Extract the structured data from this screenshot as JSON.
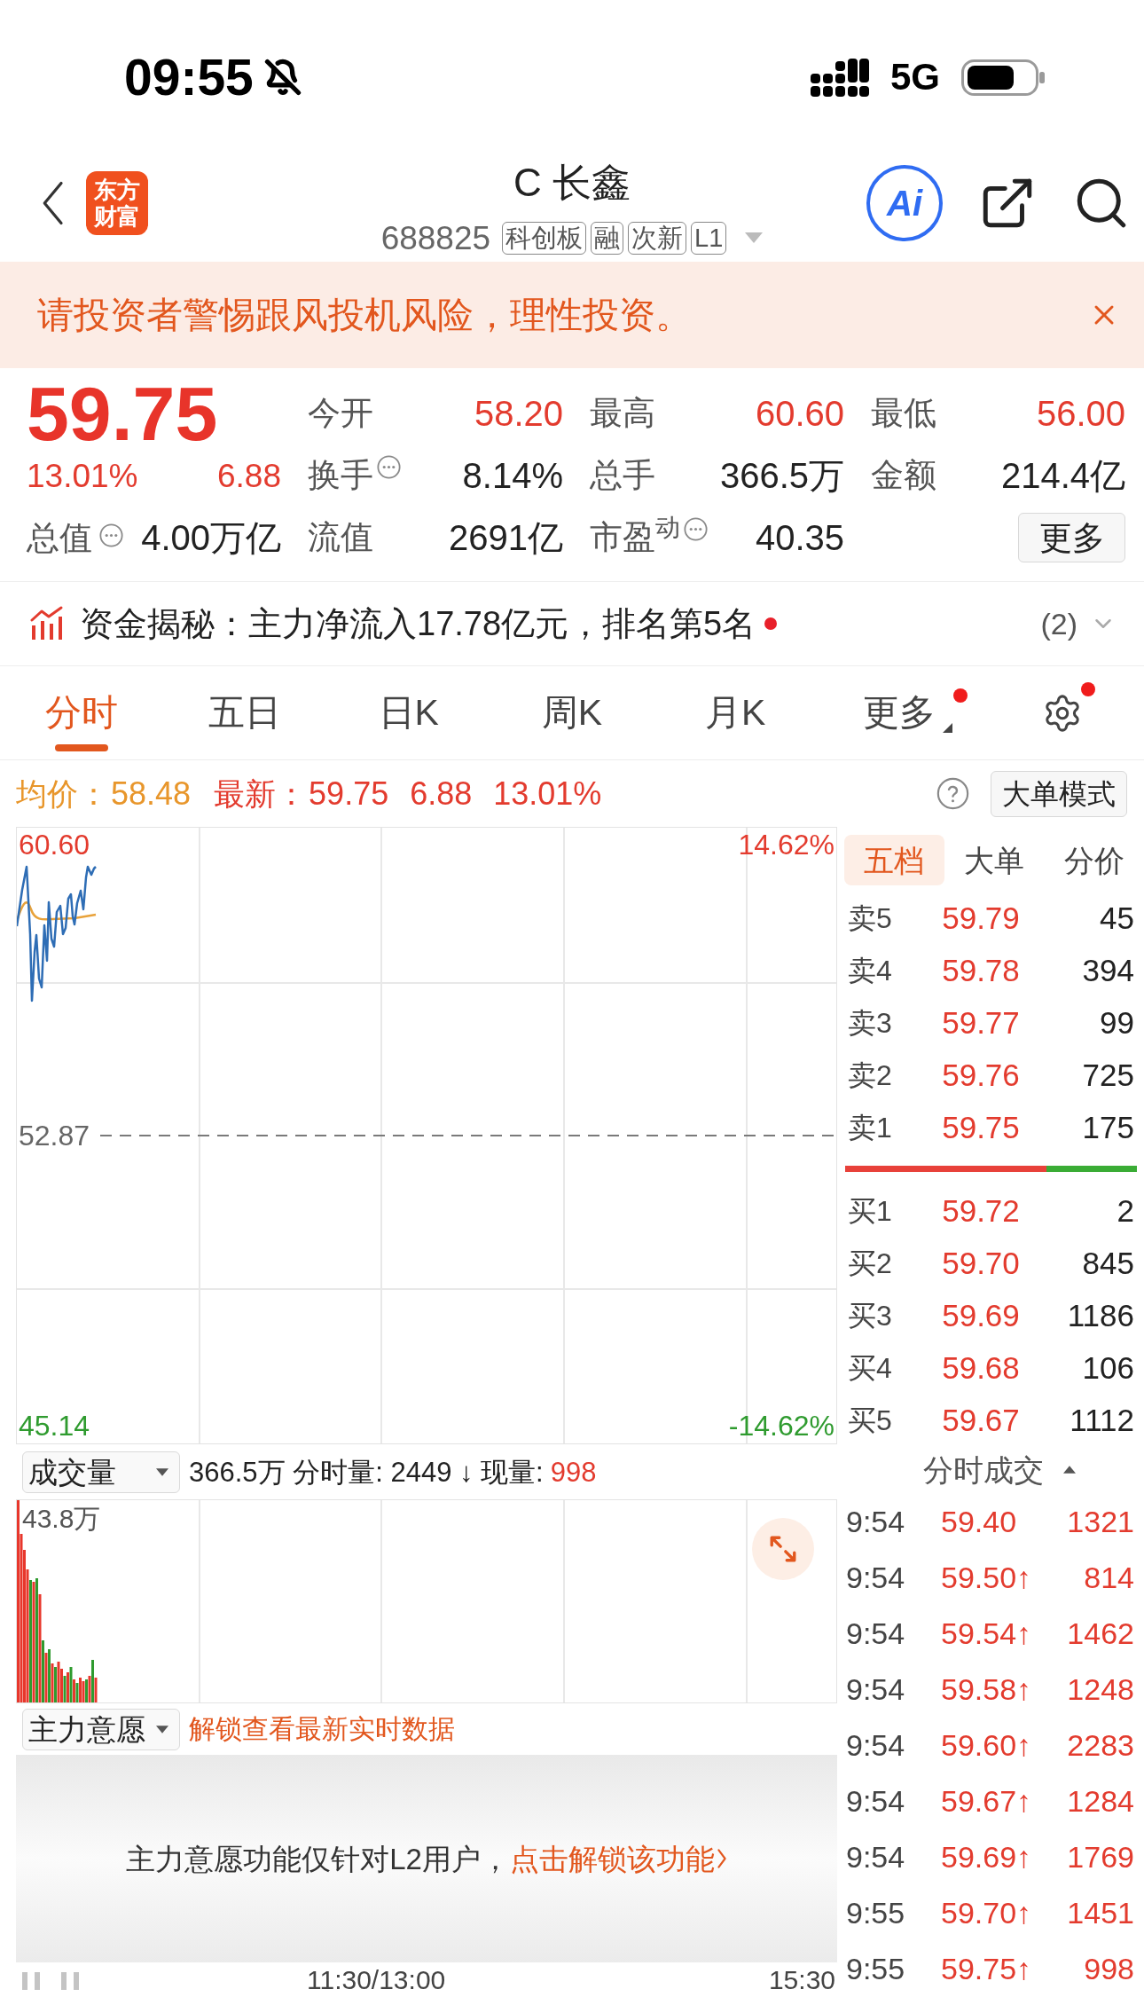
{
  "status_bar": {
    "time": "09:55",
    "network": "5G"
  },
  "header": {
    "logo": [
      "东方",
      "财富"
    ],
    "title": "C 长鑫",
    "code": "688825",
    "tags": [
      "科创板",
      "融",
      "次新",
      "L1"
    ],
    "ai_button": "Ai"
  },
  "notice": {
    "text": "请投资者警惕跟风投机风险，理性投资。"
  },
  "quote": {
    "price": "59.75",
    "change_pct": "13.01%",
    "change": "6.88",
    "total_value": {
      "label": "总值",
      "info": true,
      "value": "4.00万亿"
    },
    "stats": [
      [
        {
          "label": "今开",
          "info": false,
          "value": "58.20",
          "color": "#e33b2e"
        },
        {
          "label": "最高",
          "info": false,
          "value": "60.60",
          "color": "#e33b2e"
        },
        {
          "label": "最低",
          "info": false,
          "value": "56.00",
          "color": "#e33b2e"
        }
      ],
      [
        {
          "label": "换手",
          "info": true,
          "value": "8.14%",
          "color": "#222222"
        },
        {
          "label": "总手",
          "info": false,
          "value": "366.5万",
          "color": "#222222"
        },
        {
          "label": "金额",
          "info": false,
          "value": "214.4亿",
          "color": "#222222"
        }
      ],
      [
        {
          "label": "流值",
          "info": false,
          "value": "2691亿",
          "color": "#222222"
        },
        {
          "label": "市盈$^{动}$",
          "info": true,
          "value": "40.35",
          "color": "#222222"
        }
      ]
    ],
    "more_button": "更多"
  },
  "fund_flow": {
    "text": "资金揭秘：主力净流入17.78亿元，排名第5名",
    "unread": true,
    "count": "(2)"
  },
  "tabs": [
    {
      "label": "分时",
      "kind": "period",
      "selected": true,
      "badge": false
    },
    {
      "label": "五日",
      "kind": "period",
      "selected": false,
      "badge": false
    },
    {
      "label": "日K",
      "kind": "period",
      "selected": false,
      "badge": false
    },
    {
      "label": "周K",
      "kind": "period",
      "selected": false,
      "badge": false
    },
    {
      "label": "月K",
      "kind": "period",
      "selected": false,
      "badge": false
    },
    {
      "label": "更多",
      "kind": "menu",
      "selected": false,
      "badge": true
    }
  ],
  "settings": {
    "badge": true
  },
  "summary": {
    "avg_label": "均价：",
    "avg": "58.48",
    "latest_label": "最新：",
    "latest": "59.75",
    "change": "6.88",
    "change_pct": "13.01%",
    "mode_button": "大单模式"
  },
  "chart": {
    "high": "60.60",
    "high_pct": "14.62%",
    "prev_close": "52.87",
    "low": "45.14",
    "low_pct": "-14.62%"
  },
  "order_book": {
    "tabs": [
      {
        "label": "五档",
        "selected": true
      },
      {
        "label": "大单",
        "selected": false
      },
      {
        "label": "分价",
        "selected": false
      }
    ],
    "asks": [
      {
        "label": "卖5",
        "price": "59.79",
        "volume": "45"
      },
      {
        "label": "卖4",
        "price": "59.78",
        "volume": "394"
      },
      {
        "label": "卖3",
        "price": "59.77",
        "volume": "99"
      },
      {
        "label": "卖2",
        "price": "59.76",
        "volume": "725"
      },
      {
        "label": "卖1",
        "price": "59.75",
        "volume": "175"
      }
    ],
    "balance": {
      "level": 0.69
    },
    "bids": [
      {
        "label": "买1",
        "price": "59.72",
        "volume": "2"
      },
      {
        "label": "买2",
        "price": "59.70",
        "volume": "845"
      },
      {
        "label": "买3",
        "price": "59.69",
        "volume": "1186"
      },
      {
        "label": "买4",
        "price": "59.68",
        "volume": "106"
      },
      {
        "label": "买5",
        "price": "59.67",
        "volume": "1112"
      }
    ]
  },
  "volume": {
    "selector": "成交量",
    "summary": "366.5万 分时量: 2449 ↓ 现量:",
    "current": "998",
    "max": "43.8万"
  },
  "intent": {
    "selector": "主力意愿",
    "hint": "解锁查看最新实时数据",
    "message": "主力意愿功能仅针对L2用户，",
    "link": "点击解锁该功能"
  },
  "trades": {
    "title": "分时成交",
    "rows": [
      {
        "time": "9:54",
        "price": "59.40",
        "volume": "1321"
      },
      {
        "time": "9:54",
        "price": "59.50↑",
        "volume": "814"
      },
      {
        "time": "9:54",
        "price": "59.54↑",
        "volume": "1462"
      },
      {
        "time": "9:54",
        "price": "59.58↑",
        "volume": "1248"
      },
      {
        "time": "9:54",
        "price": "59.60↑",
        "volume": "2283"
      },
      {
        "time": "9:54",
        "price": "59.67↑",
        "volume": "1284"
      },
      {
        "time": "9:54",
        "price": "59.69↑",
        "volume": "1769"
      },
      {
        "time": "9:55",
        "price": "59.70↑",
        "volume": "1451"
      },
      {
        "time": "9:55",
        "price": "59.75↑",
        "volume": "998"
      }
    ]
  },
  "time_axis": {
    "mid": "11:30/13:00",
    "end": "15:30"
  }
}
